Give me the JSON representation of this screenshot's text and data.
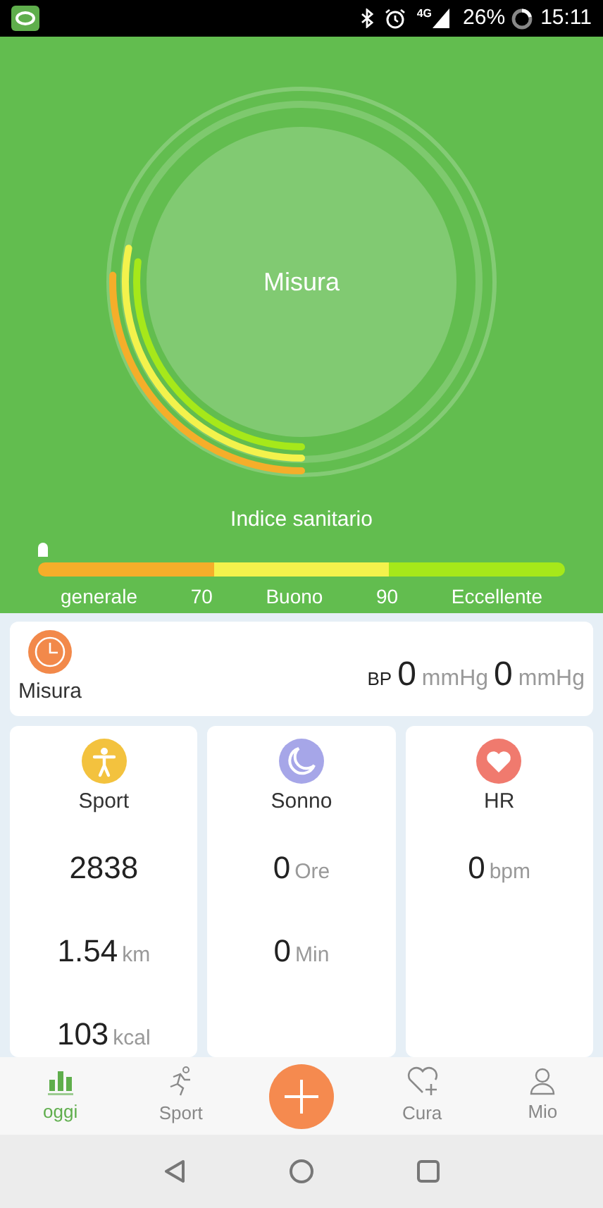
{
  "status_bar": {
    "network": "4G",
    "battery": "26%",
    "time": "15:11"
  },
  "health": {
    "button": "Misura",
    "title": "Indice sanitario",
    "segments": [
      {
        "color": "#f5ae2a"
      },
      {
        "color": "#f3f24c"
      },
      {
        "color": "#a6e81a"
      }
    ],
    "labels": [
      "generale",
      "70",
      "Buono",
      "90",
      "Eccellente"
    ]
  },
  "bp_card": {
    "title": "Misura",
    "prefix": "BP",
    "values": [
      {
        "value": "0",
        "unit": "mmHg"
      },
      {
        "value": "0",
        "unit": "mmHg"
      }
    ]
  },
  "cards": [
    {
      "kind": "sport",
      "title": "Sport",
      "rows": [
        {
          "value": "2838"
        },
        {
          "value": "1.54",
          "unit": "km"
        },
        {
          "value": "103",
          "unit": "kcal"
        }
      ]
    },
    {
      "kind": "sleep",
      "title": "Sonno",
      "rows": [
        {
          "value": "0",
          "unit": "Ore"
        },
        {
          "value": "0",
          "unit": "Min"
        }
      ]
    },
    {
      "kind": "heart",
      "title": "HR",
      "rows": [
        {
          "value": "0",
          "unit": "bpm"
        }
      ]
    }
  ],
  "nav": [
    {
      "kind": "today",
      "label": "oggi",
      "selected": true
    },
    {
      "kind": "sport",
      "label": "Sport",
      "selected": false
    },
    {
      "kind": "add",
      "selected": false
    },
    {
      "kind": "care",
      "label": "Cura",
      "selected": false
    },
    {
      "kind": "me",
      "label": "Mio",
      "selected": false
    }
  ]
}
